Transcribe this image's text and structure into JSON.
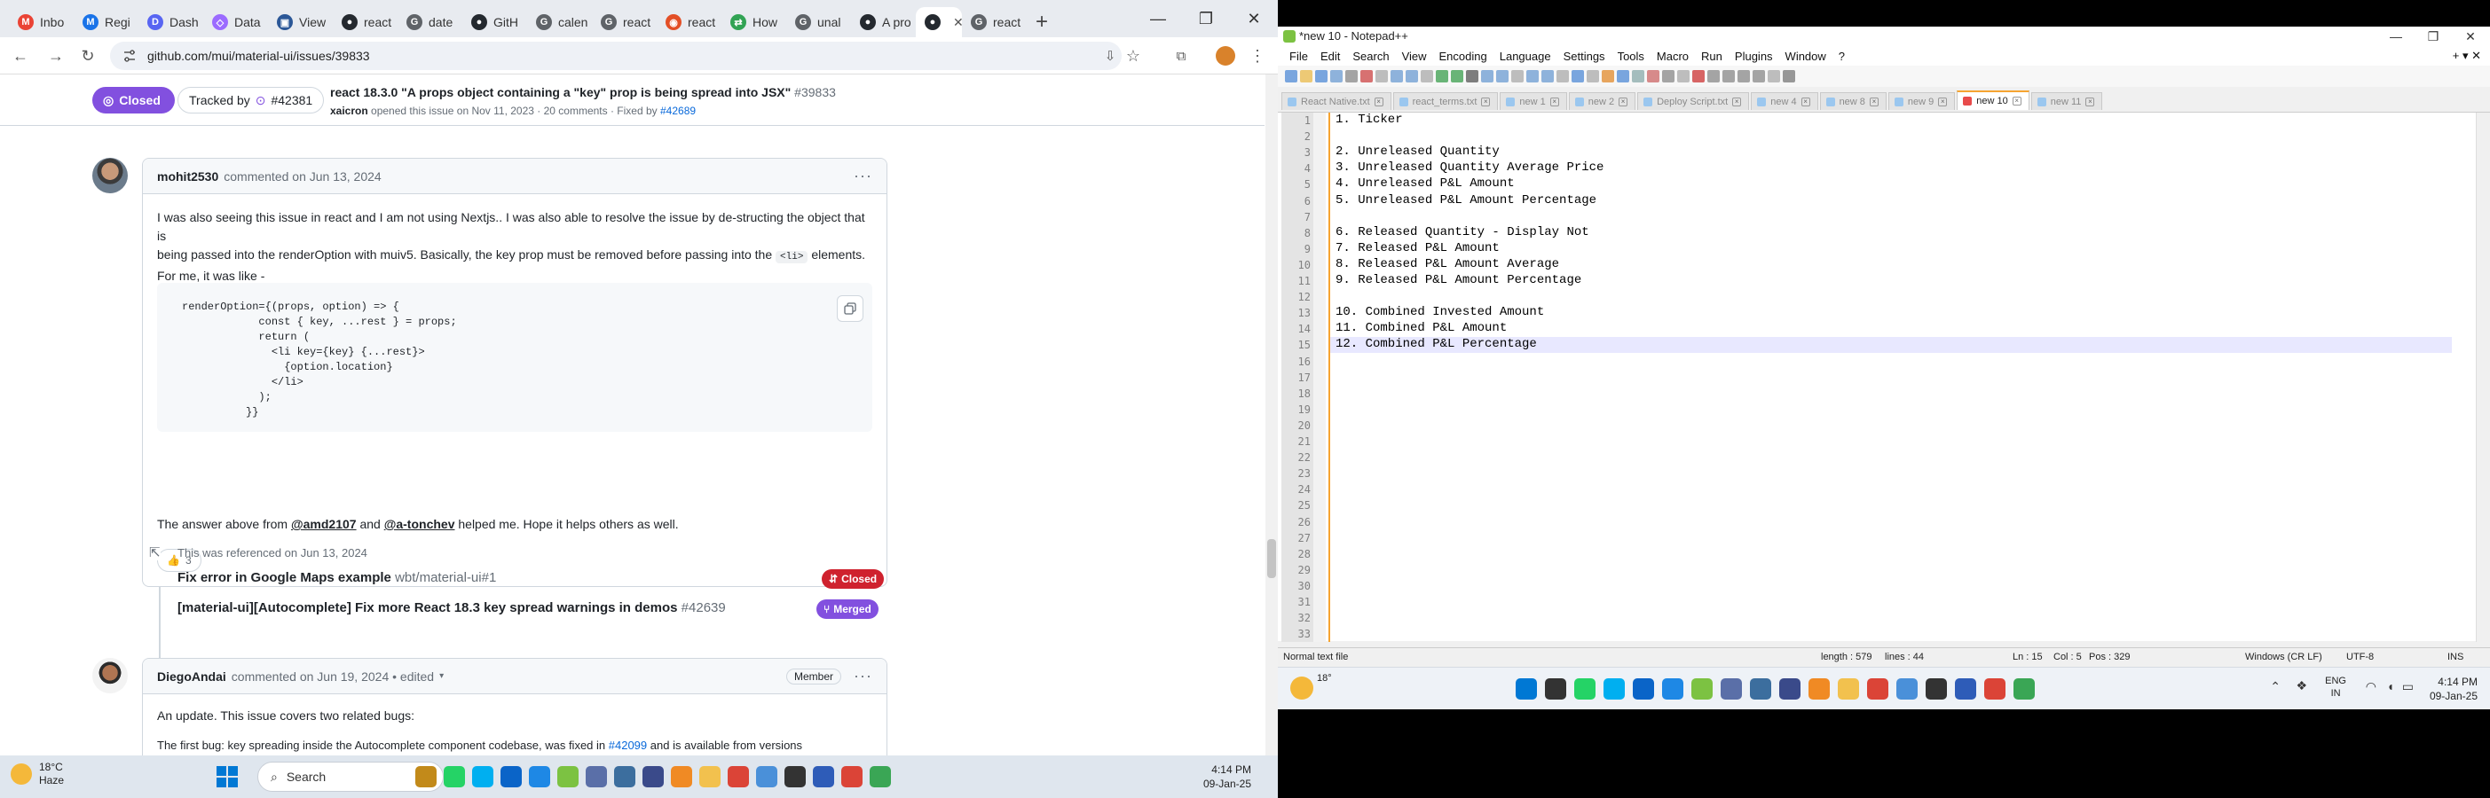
{
  "browser": {
    "tabs": [
      {
        "label": "Inbo",
        "fav_color": "#ea4335",
        "fav_glyph": "M"
      },
      {
        "label": "Regi",
        "fav_color": "#1a73e8",
        "fav_glyph": "M"
      },
      {
        "label": "Dash",
        "fav_color": "#5865f2",
        "fav_glyph": "D"
      },
      {
        "label": "Data",
        "fav_color": "#9b6bff",
        "fav_glyph": "◇"
      },
      {
        "label": "View",
        "fav_color": "#2b5797",
        "fav_glyph": "▣"
      },
      {
        "label": "react",
        "fav_color": "#24292f",
        "fav_glyph": "●"
      },
      {
        "label": "date",
        "fav_color": "#5f6368",
        "fav_glyph": "G"
      },
      {
        "label": "GitH",
        "fav_color": "#24292f",
        "fav_glyph": "●"
      },
      {
        "label": "calen",
        "fav_color": "#5f6368",
        "fav_glyph": "G"
      },
      {
        "label": "react",
        "fav_color": "#5f6368",
        "fav_glyph": "G"
      },
      {
        "label": "react",
        "fav_color": "#e34f26",
        "fav_glyph": "◉"
      },
      {
        "label": "How",
        "fav_color": "#31a354",
        "fav_glyph": "⇄"
      },
      {
        "label": "unal",
        "fav_color": "#5f6368",
        "fav_glyph": "G"
      },
      {
        "label": "A pro",
        "fav_color": "#24292f",
        "fav_glyph": "●"
      },
      {
        "label": "",
        "fav_color": "#24292f",
        "fav_glyph": "●",
        "active": true
      },
      {
        "label": "react",
        "fav_color": "#5f6368",
        "fav_glyph": "G"
      }
    ],
    "url": "github.com/mui/material-ui/issues/39833"
  },
  "issue": {
    "state": "Closed",
    "tracked_by": "Tracked by",
    "tracked_num": "#42381",
    "title": "react 18.3.0 \"A props object containing a \"key\" prop is being spread into JSX\"",
    "number": "#39833",
    "meta_author": "xaicron",
    "meta_rest": "opened this issue on Nov 11, 2023 · 20 comments · Fixed by",
    "meta_fix": "#42689"
  },
  "comment1": {
    "author": "mohit2530",
    "date": "commented on Jun 13, 2024",
    "p1_a": "I was also seeing this issue in react and I am not using Nextjs.. I was also able to resolve the issue by de-structing the object that is",
    "p1_b": "being passed into the renderOption with muiv5. Basically, the key prop must be removed before passing into the",
    "p1_code": "<li>",
    "p1_c": "elements.",
    "p1_d": "For me, it was like -",
    "code": [
      "renderOption={(props, option) => {",
      "            const { key, ...rest } = props;",
      "            return (",
      "              <li key={key} {...rest}>",
      "                {option.location}",
      "              </li>",
      "            );",
      "          }}"
    ],
    "p2_a": "The answer above from",
    "p2_m1": "@amd2107",
    "p2_and": "and",
    "p2_m2": "@a-tonchev",
    "p2_b": "helped me. Hope it helps others as well.",
    "reaction_emoji": "👍",
    "reaction_count": "3"
  },
  "reference": {
    "text": "This was referenced on Jun 13, 2024",
    "items": [
      {
        "title": "Fix error in Google Maps example",
        "sub": "wbt/material-ui#1",
        "badge": "Closed",
        "badge_color": "#cf222e"
      },
      {
        "title": "[material-ui][Autocomplete] Fix more React 18.3 key spread warnings in demos",
        "sub": "#42639",
        "badge": "Merged",
        "badge_color": "#8250df"
      }
    ]
  },
  "comment2": {
    "author": "DiegoAndai",
    "date": "commented on Jun 19, 2024 • edited",
    "role": "Member",
    "p1": "An update. This issue covers two related bugs:",
    "p2_a": "The first bug: key spreading inside the Autocomplete component codebase, was fixed in",
    "p2_link": "#42099",
    "p2_b": "and is available from versions"
  },
  "taskbar_left": {
    "temp": "18°C",
    "weather": "Haze",
    "search": "Search",
    "time": "4:14 PM",
    "date": "09-Jan-25"
  },
  "npp": {
    "title": "*new 10 - Notepad++",
    "menu": [
      "File",
      "Edit",
      "Search",
      "View",
      "Encoding",
      "Language",
      "Settings",
      "Tools",
      "Macro",
      "Run",
      "Plugins",
      "Window",
      "?"
    ],
    "menu_right": "+ ▾ ✕",
    "tabs": [
      "React Native.txt",
      "react_terms.txt",
      "new 1",
      "new 2",
      "Deploy Script.txt",
      "new 4",
      "new 8",
      "new 9",
      "new 10",
      "new 11"
    ],
    "active_tab_index": 8,
    "lines": [
      "1. Ticker",
      "",
      "2. Unreleased Quantity",
      "3. Unreleased Quantity Average Price",
      "4. Unreleased P&L Amount",
      "5. Unreleased P&L Amount Percentage",
      "",
      "6. Released Quantity - Display Not",
      "7. Released P&L Amount",
      "8. Released P&L Amount Average",
      "9. Released P&L Amount Percentage",
      "",
      "10. Combined Invested Amount",
      "11. Combined P&L Amount",
      "12. Combined P&L Percentage",
      "",
      "",
      "",
      "",
      "",
      "",
      "",
      "",
      "",
      "",
      "",
      "",
      "",
      "",
      "",
      "",
      "",
      ""
    ],
    "current_line": 15,
    "status": {
      "type": "Normal text file",
      "length": "length : 579",
      "lines": "lines : 44",
      "ln": "Ln : 15",
      "col": "Col : 5",
      "pos": "Pos : 329",
      "eol": "Windows (CR LF)",
      "enc": "UTF-8",
      "ins": "INS"
    }
  },
  "taskbar_right": {
    "temp": "18°",
    "lang1": "ENG",
    "lang2": "IN",
    "time": "4:14 PM",
    "date": "09-Jan-25"
  }
}
